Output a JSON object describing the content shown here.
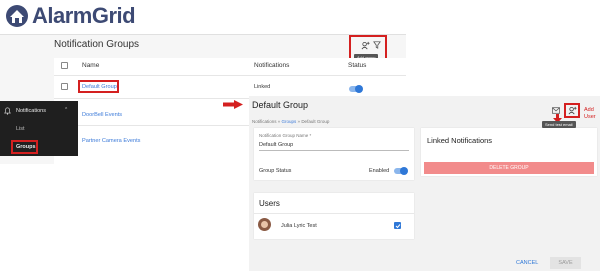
{
  "brand": {
    "logo_text": "AlarmGrid"
  },
  "list_view": {
    "title": "Notification Groups",
    "columns": [
      "Name",
      "Notifications",
      "Status"
    ],
    "rows": [
      {
        "name": "Default Group",
        "notifications": "Linked"
      },
      {
        "name": "DoorBell Events"
      },
      {
        "name": "Partner Camera Events"
      }
    ],
    "add_group_tooltip": "Add group"
  },
  "sidebar": {
    "section": "Notifications",
    "items": [
      {
        "label": "List"
      },
      {
        "label": "Groups"
      }
    ]
  },
  "detail_view": {
    "title": "Default Group",
    "breadcrumb": {
      "root": "Notifications",
      "sep1": " » ",
      "groups": "Groups",
      "sep2": " » ",
      "current": "Default Group"
    },
    "name_field_label": "Notification Group Name *",
    "name_field_value": "Default Group",
    "group_status_label": "Group Status",
    "group_status_value": "Enabled",
    "linked_notifications_title": "Linked Notifications",
    "delete_button": "DELETE GROUP",
    "users_title": "Users",
    "users": [
      {
        "name": "Julia Lyric Test",
        "checked": true
      }
    ],
    "cancel_button": "CANCEL",
    "save_button": "SAVE",
    "send_test_tooltip": "Send test email",
    "add_user_annotation_line1": "Add",
    "add_user_annotation_line2": "User"
  },
  "colors": {
    "accent": "#2f78d7",
    "highlight": "#d42020",
    "delete": "#f28b8b",
    "sidebar": "#1f1f1f",
    "brand": "#3d4a74"
  }
}
